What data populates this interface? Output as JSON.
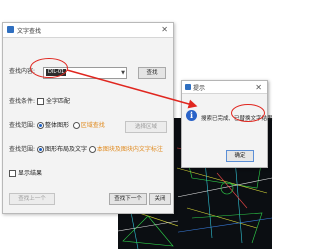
{
  "find_dialog": {
    "title": "文字查找",
    "close_glyph": "✕",
    "search_label": "查找内容:",
    "search_value": "DIL-01",
    "search_button": "查找",
    "condition_label": "查找条件:",
    "whole_word_label": "全字匹配",
    "scope_label": "查找范围:",
    "scope_options": [
      "整体图形",
      "区域查找"
    ],
    "pick_area_button": "选择区域",
    "range_label": "查找范围:",
    "range_options": [
      "图形布局及文字",
      "本图块及图块内文字标注"
    ],
    "show_result_label": "显示结果",
    "prev_button": "查找上一个",
    "next_button": "查找下一个",
    "close_button": "关闭"
  },
  "prompt_dialog": {
    "title": "提示",
    "close_glyph": "✕",
    "message_part1": "搜索已完成,",
    "message_part2": "已替换文字结果",
    "ok_button": "确定"
  },
  "colors": {
    "highlight_red": "#e0261f",
    "accent_blue": "#2a63c8",
    "cad_background": "#0b0e12"
  },
  "icons": {
    "info": "information-icon",
    "app": "app-icon"
  }
}
